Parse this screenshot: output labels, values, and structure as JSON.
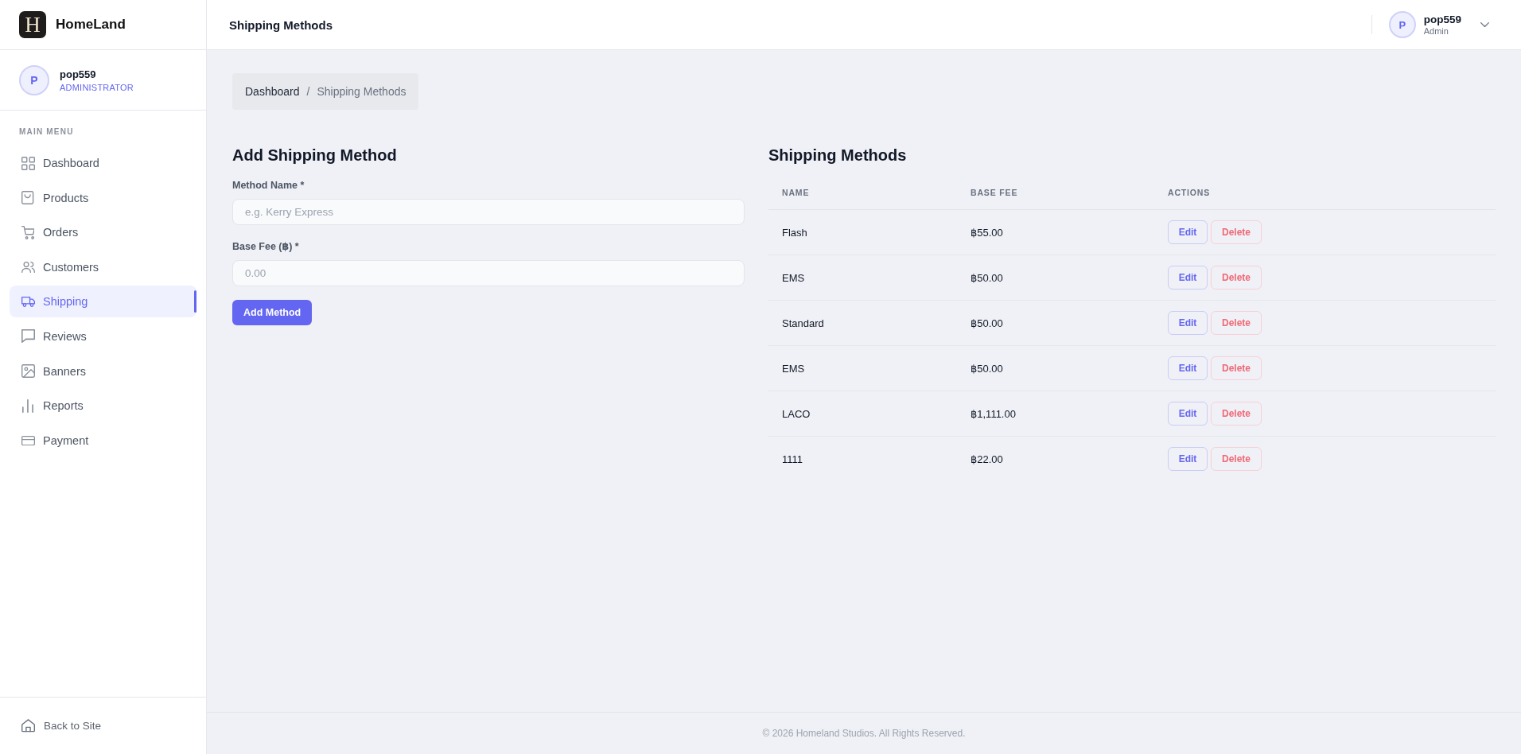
{
  "brand": {
    "logo_text": "H",
    "name": "HomeLand"
  },
  "sidebar": {
    "user": {
      "avatar_initial": "P",
      "name": "pop559",
      "role": "ADMINISTRATOR"
    },
    "section_label": "MAIN MENU",
    "items": [
      {
        "label": "Dashboard",
        "selected": false
      },
      {
        "label": "Products",
        "selected": false
      },
      {
        "label": "Orders",
        "selected": false
      },
      {
        "label": "Customers",
        "selected": false
      },
      {
        "label": "Shipping",
        "selected": true
      },
      {
        "label": "Reviews",
        "selected": false
      },
      {
        "label": "Banners",
        "selected": false
      },
      {
        "label": "Reports",
        "selected": false
      },
      {
        "label": "Payment",
        "selected": false
      }
    ],
    "footer_link": {
      "label": "Back to Site"
    }
  },
  "header": {
    "title": "Shipping Methods",
    "user": {
      "avatar_initial": "P",
      "name": "pop559",
      "role": "Admin"
    }
  },
  "breadcrumb": {
    "separator": "/",
    "items": [
      {
        "label": "Dashboard",
        "kind": "link"
      },
      {
        "label": "Shipping Methods",
        "kind": "current"
      }
    ]
  },
  "form": {
    "title": "Add Shipping Method",
    "fields": [
      {
        "label": "Method Name *",
        "placeholder": "e.g. Kerry Express"
      },
      {
        "label": "Base Fee (฿) *",
        "placeholder": "0.00"
      }
    ],
    "submit": "Add Method"
  },
  "table": {
    "title": "Shipping Methods",
    "columns": [
      "NAME",
      "BASE FEE",
      "ACTIONS"
    ],
    "rows": [
      {
        "name": "Flash",
        "base_fee": "฿55.00",
        "actions": [
          {
            "label": "Edit",
            "kind": "edit"
          },
          {
            "label": "Delete",
            "kind": "delete"
          }
        ]
      },
      {
        "name": "EMS",
        "base_fee": "฿50.00",
        "actions": [
          {
            "label": "Edit",
            "kind": "edit"
          },
          {
            "label": "Delete",
            "kind": "delete"
          }
        ]
      },
      {
        "name": "Standard",
        "base_fee": "฿50.00",
        "actions": [
          {
            "label": "Edit",
            "kind": "edit"
          },
          {
            "label": "Delete",
            "kind": "delete"
          }
        ]
      },
      {
        "name": "EMS",
        "base_fee": "฿50.00",
        "actions": [
          {
            "label": "Edit",
            "kind": "edit"
          },
          {
            "label": "Delete",
            "kind": "delete"
          }
        ]
      },
      {
        "name": "LACO",
        "base_fee": "฿1,111.00",
        "actions": [
          {
            "label": "Edit",
            "kind": "edit"
          },
          {
            "label": "Delete",
            "kind": "delete"
          }
        ]
      },
      {
        "name": "1111",
        "base_fee": "฿22.00",
        "actions": [
          {
            "label": "Edit",
            "kind": "edit"
          },
          {
            "label": "Delete",
            "kind": "delete"
          }
        ]
      }
    ]
  },
  "footer": {
    "text": "© 2026 Homeland Studios. All Rights Reserved."
  }
}
